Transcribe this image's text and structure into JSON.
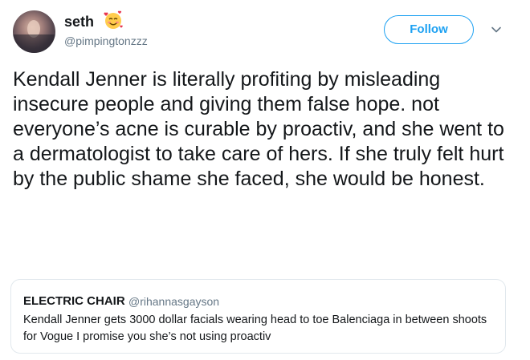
{
  "user": {
    "display_name": "seth",
    "handle": "@pimpingtonzzz",
    "emoji": "smiling-face-with-hearts-icon"
  },
  "follow_button": {
    "label": "Follow"
  },
  "tweet": {
    "text": "Kendall Jenner is literally profiting by misleading insecure people and giving them false hope. not everyone’s acne is curable by proactiv, and she went to a dermatologist to take care of hers. If she truly felt hurt by the public shame she faced, she would be honest."
  },
  "quoted_tweet": {
    "display_name": "ELECTRIC CHAIR",
    "handle": "@rihannasgayson",
    "text": "Kendall Jenner gets 3000 dollar facials wearing head to toe Balenciaga in between shoots for Vogue I promise you she’s not using proactiv"
  },
  "colors": {
    "accent": "#1da1f2",
    "text": "#14171a",
    "secondary_text": "#657786",
    "border": "#e1e8ed"
  }
}
